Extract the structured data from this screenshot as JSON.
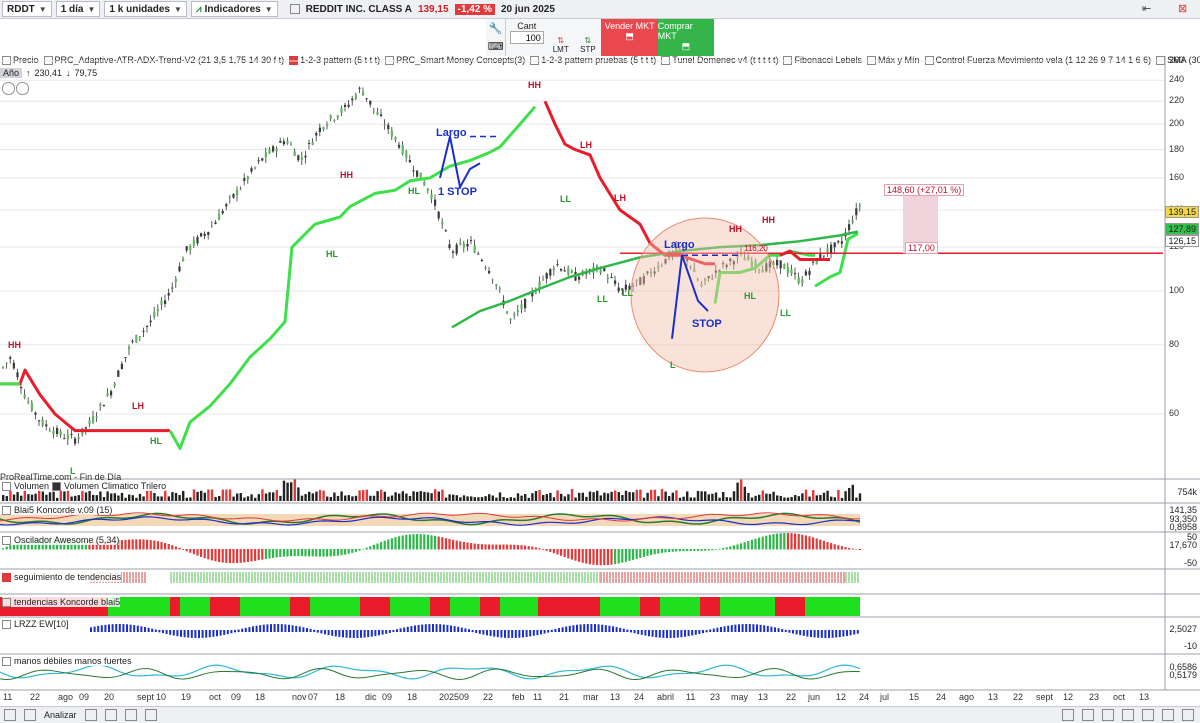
{
  "toolbar": {
    "symbol": "RDDT",
    "timeframe": "1 día",
    "units": "1 k unidades",
    "indicators_label": "Indicadores",
    "instrument_name": "REDDIT INC. CLASS A",
    "last_price": "139,15",
    "change_pct": "-1,42 %",
    "date": "20 jun 2025"
  },
  "order_panel": {
    "qty_label": "Cant",
    "qty_value": "100",
    "lmt_label": "LMT",
    "stp_label": "STP",
    "sell_label": "Vender MKT",
    "buy_label": "Comprar MKT"
  },
  "indicator_bar": [
    {
      "label": "Precio",
      "color": ""
    },
    {
      "label": "PRC_Adaptive-ATR-ADX-Trend-V2 (21 3,5 1,75 14 30 f t)",
      "color": ""
    },
    {
      "label": "1-2-3 pattern (5 t t t)",
      "color": "#e03a3a"
    },
    {
      "label": "PRC_Smart Money Concepts(3)",
      "color": ""
    },
    {
      "label": "1-2-3 pattern pruebas (5 t t t)",
      "color": ""
    },
    {
      "label": "Tunel Domenec v4 (t t t t t)",
      "color": ""
    },
    {
      "label": "Fibonacci Lebels",
      "color": ""
    },
    {
      "label": "Máx y Mín",
      "color": ""
    },
    {
      "label": "Control Fuerza Movimiento vela (1 12 26 9 7 14 1 6 6)",
      "color": ""
    },
    {
      "label": "SMA (30)",
      "color": ""
    }
  ],
  "info_line": {
    "year_tag": "Año",
    "high": "230,41",
    "low": "79,75"
  },
  "main_chart": {
    "price_ticks": [
      "260",
      "240",
      "220",
      "200",
      "180",
      "160",
      "140",
      "120",
      "100",
      "80",
      "60"
    ],
    "labels": {
      "hh_top": "HH",
      "lh": "LH",
      "hl": "HL",
      "ll": "LL",
      "l": "L",
      "largo": "Largo",
      "stop": "STOP",
      "one_stop": "1 STOP",
      "level_116": "116,20"
    },
    "target_box": "148,60 (+27,01 %)",
    "level_box": "117,00",
    "price_tags": [
      {
        "text": "139,15",
        "bg": "#f2d648"
      },
      {
        "text": "127,89",
        "bg": "#33c04a"
      },
      {
        "text": "126,15",
        "bg": "#ffffff"
      }
    ],
    "source_label": "ProRealTime.com - Fin de Día"
  },
  "panes": {
    "volume": {
      "labels": [
        "Volumen",
        "Volumen Climatico Trilero"
      ],
      "scale": "754k"
    },
    "koncorde": {
      "label": "Blai5 Koncorde v.09 (15)",
      "scale": [
        "141,35",
        "93,350",
        "0,8958"
      ]
    },
    "awesome": {
      "label": "Oscilador Awesome (5,34)",
      "scale": [
        "50",
        "17,670",
        "-50"
      ]
    },
    "seguimiento": {
      "label": "seguimiento de tendencias"
    },
    "tendencias": {
      "label": "tendencias Koncorde blai5"
    },
    "lrzz": {
      "label": "LRZZ EW[10]",
      "scale": [
        "2,5027",
        "-10"
      ]
    },
    "manos": {
      "label": "manos débiles  manos fuertes",
      "scale": [
        "0,6586",
        "0,5179"
      ]
    }
  },
  "time_axis": [
    {
      "label": "11"
    },
    {
      "label": "22"
    },
    {
      "label": "ago"
    },
    {
      "label": "09"
    },
    {
      "label": "20"
    },
    {
      "label": "sept"
    },
    {
      "label": "10"
    },
    {
      "label": "19"
    },
    {
      "label": "oct"
    },
    {
      "label": "09"
    },
    {
      "label": "18"
    },
    {
      "label": "nov"
    },
    {
      "label": "07"
    },
    {
      "label": "18"
    },
    {
      "label": "dic"
    },
    {
      "label": "09"
    },
    {
      "label": "18"
    },
    {
      "label": "2025"
    },
    {
      "label": "09"
    },
    {
      "label": "22"
    },
    {
      "label": "feb"
    },
    {
      "label": "11"
    },
    {
      "label": "21"
    },
    {
      "label": "mar"
    },
    {
      "label": "13"
    },
    {
      "label": "24"
    },
    {
      "label": "abril"
    },
    {
      "label": "11"
    },
    {
      "label": "23"
    },
    {
      "label": "may"
    },
    {
      "label": "13"
    },
    {
      "label": "22"
    },
    {
      "label": "jun"
    },
    {
      "label": "12"
    },
    {
      "label": "24"
    },
    {
      "label": "jul"
    },
    {
      "label": "15"
    },
    {
      "label": "24"
    },
    {
      "label": "ago"
    },
    {
      "label": "13"
    },
    {
      "label": "22"
    },
    {
      "label": "sept"
    },
    {
      "label": "12"
    },
    {
      "label": "23"
    },
    {
      "label": "oct"
    },
    {
      "label": "13"
    }
  ],
  "bottom_bar": {
    "analyze": "Analizar"
  },
  "colors": {
    "up": "#2db84a",
    "down": "#e03a3a",
    "trail_green": "#3ee04a",
    "trail_red": "#e81c2a",
    "sma": "#2fb84a",
    "pattern_blue": "#1a2fc8"
  }
}
